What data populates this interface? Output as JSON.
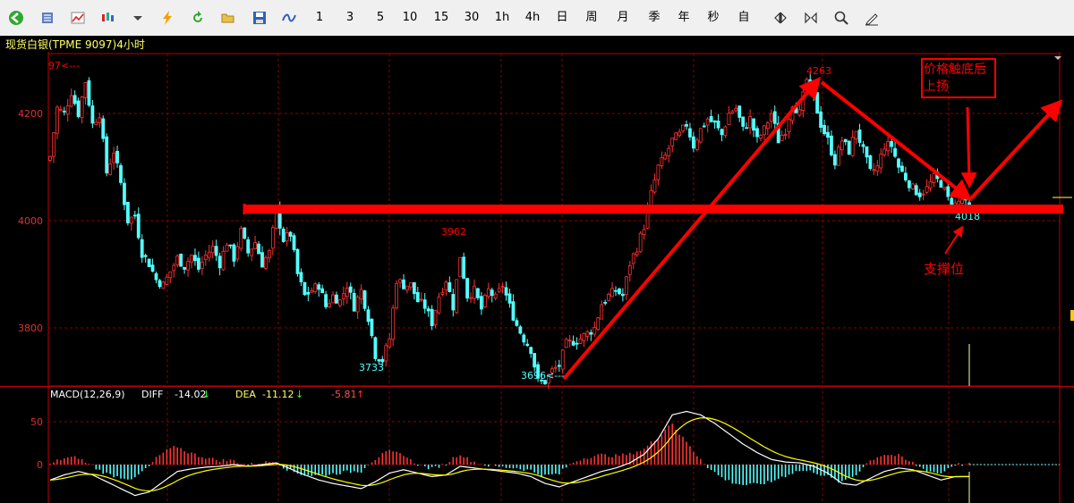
{
  "toolbar": {
    "icons": [
      "back-icon",
      "list-icon",
      "line-chart-icon",
      "candlestick-icon",
      "dropdown-arrow-icon",
      "lightning-icon",
      "refresh-icon",
      "open-folder-icon",
      "save-icon",
      "indicator-wave-icon"
    ],
    "periods": [
      "1",
      "3",
      "5",
      "10",
      "15",
      "30",
      "1h",
      "4h",
      "日",
      "周",
      "月",
      "季",
      "年",
      "秒",
      "自"
    ],
    "tools": [
      "zoom-in-out-icon",
      "zoom-fit-icon",
      "search-icon",
      "draw-pen-icon"
    ]
  },
  "title": "现货白银(TPME 9097)4小时",
  "colors": {
    "up": "#ff3232",
    "down": "#54ffff",
    "grid": "#8b0000",
    "axis": "#c00000",
    "annot": "#ff0000",
    "diff": "#ffffff",
    "dea": "#ffff00"
  },
  "chart_data": [
    {
      "type": "candlestick",
      "title": "现货白银(TPME 9097)4小时",
      "yticks": [
        3800,
        4000,
        4200
      ],
      "ylim": [
        3686,
        4313
      ],
      "grid": true,
      "price_labels": [
        {
          "text": "4263",
          "value": 4263
        },
        {
          "text": "3962",
          "value": 3962
        },
        {
          "text": "3733",
          "value": 3733
        },
        {
          "text": "3696<----",
          "value": 3696
        },
        {
          "text": "4018",
          "value": 4018
        },
        {
          "text": "97<---",
          "value": 4297
        }
      ],
      "waypoints": [
        [
          0,
          4120
        ],
        [
          2,
          4210
        ],
        [
          4,
          4200
        ],
        [
          6,
          4240
        ],
        [
          8,
          4200
        ],
        [
          10,
          4260
        ],
        [
          12,
          4180
        ],
        [
          14,
          4200
        ],
        [
          16,
          4090
        ],
        [
          18,
          4130
        ],
        [
          20,
          4070
        ],
        [
          22,
          4000
        ],
        [
          24,
          4010
        ],
        [
          26,
          3940
        ],
        [
          28,
          3920
        ],
        [
          30,
          3890
        ],
        [
          32,
          3880
        ],
        [
          34,
          3905
        ],
        [
          36,
          3930
        ],
        [
          38,
          3915
        ],
        [
          40,
          3935
        ],
        [
          42,
          3910
        ],
        [
          44,
          3935
        ],
        [
          46,
          3950
        ],
        [
          48,
          3920
        ],
        [
          50,
          3960
        ],
        [
          52,
          3930
        ],
        [
          54,
          3980
        ],
        [
          56,
          3940
        ],
        [
          58,
          3960
        ],
        [
          60,
          3920
        ],
        [
          62,
          3940
        ],
        [
          64,
          4020
        ],
        [
          66,
          3965
        ],
        [
          68,
          3975
        ],
        [
          70,
          3900
        ],
        [
          72,
          3860
        ],
        [
          74,
          3870
        ],
        [
          76,
          3880
        ],
        [
          78,
          3840
        ],
        [
          80,
          3860
        ],
        [
          82,
          3850
        ],
        [
          84,
          3880
        ],
        [
          86,
          3840
        ],
        [
          88,
          3870
        ],
        [
          90,
          3820
        ],
        [
          92,
          3750
        ],
        [
          94,
          3740
        ],
        [
          96,
          3780
        ],
        [
          98,
          3890
        ],
        [
          100,
          3880
        ],
        [
          102,
          3880
        ],
        [
          104,
          3850
        ],
        [
          106,
          3840
        ],
        [
          108,
          3810
        ],
        [
          110,
          3860
        ],
        [
          112,
          3890
        ],
        [
          114,
          3840
        ],
        [
          116,
          3935
        ],
        [
          118,
          3860
        ],
        [
          120,
          3870
        ],
        [
          122,
          3835
        ],
        [
          124,
          3870
        ],
        [
          126,
          3855
        ],
        [
          128,
          3880
        ],
        [
          130,
          3840
        ],
        [
          132,
          3805
        ],
        [
          134,
          3780
        ],
        [
          136,
          3760
        ],
        [
          138,
          3700
        ],
        [
          140,
          3700
        ],
        [
          142,
          3720
        ],
        [
          144,
          3730
        ],
        [
          146,
          3770
        ],
        [
          148,
          3775
        ],
        [
          150,
          3780
        ],
        [
          152,
          3790
        ],
        [
          154,
          3800
        ],
        [
          156,
          3845
        ],
        [
          158,
          3860
        ],
        [
          160,
          3870
        ],
        [
          162,
          3860
        ],
        [
          164,
          3920
        ],
        [
          166,
          3950
        ],
        [
          168,
          3990
        ],
        [
          170,
          4050
        ],
        [
          172,
          4100
        ],
        [
          174,
          4120
        ],
        [
          176,
          4150
        ],
        [
          178,
          4160
        ],
        [
          180,
          4180
        ],
        [
          182,
          4140
        ],
        [
          184,
          4170
        ],
        [
          186,
          4190
        ],
        [
          188,
          4180
        ],
        [
          190,
          4160
        ],
        [
          192,
          4200
        ],
        [
          194,
          4210
        ],
        [
          196,
          4170
        ],
        [
          198,
          4190
        ],
        [
          200,
          4150
        ],
        [
          202,
          4170
        ],
        [
          204,
          4200
        ],
        [
          206,
          4150
        ],
        [
          208,
          4170
        ],
        [
          210,
          4220
        ],
        [
          212,
          4200
        ],
        [
          214,
          4263
        ],
        [
          216,
          4230
        ],
        [
          218,
          4180
        ],
        [
          220,
          4150
        ],
        [
          222,
          4110
        ],
        [
          224,
          4150
        ],
        [
          226,
          4130
        ],
        [
          228,
          4170
        ],
        [
          230,
          4130
        ],
        [
          232,
          4090
        ],
        [
          234,
          4100
        ],
        [
          236,
          4140
        ],
        [
          238,
          4140
        ],
        [
          240,
          4100
        ],
        [
          242,
          4080
        ],
        [
          244,
          4060
        ],
        [
          246,
          4050
        ],
        [
          248,
          4060
        ],
        [
          250,
          4080
        ],
        [
          252,
          4070
        ],
        [
          254,
          4040
        ],
        [
          256,
          4030
        ],
        [
          258,
          4040
        ],
        [
          260,
          4020
        ]
      ]
    },
    {
      "type": "bar",
      "title": "MACD(12,26,9)",
      "legend": [
        {
          "name": "DIFF",
          "value": "-14.02",
          "arrow": "↓"
        },
        {
          "name": "DEA",
          "value": "-11.12",
          "arrow": "↓"
        },
        {
          "name": "",
          "value": "-5.81",
          "arrow": "↑"
        }
      ],
      "yticks": [
        0,
        50
      ],
      "ylim": [
        -45,
        70
      ],
      "macd_waypoints": [
        [
          0,
          -18
        ],
        [
          4,
          -12
        ],
        [
          8,
          -8
        ],
        [
          12,
          -12
        ],
        [
          16,
          -20
        ],
        [
          20,
          -28
        ],
        [
          24,
          -36
        ],
        [
          28,
          -32
        ],
        [
          32,
          -20
        ],
        [
          36,
          -8
        ],
        [
          40,
          -5
        ],
        [
          44,
          -3
        ],
        [
          48,
          -2
        ],
        [
          52,
          0
        ],
        [
          56,
          -2
        ],
        [
          60,
          0
        ],
        [
          64,
          2
        ],
        [
          68,
          -5
        ],
        [
          72,
          -12
        ],
        [
          76,
          -18
        ],
        [
          80,
          -22
        ],
        [
          84,
          -25
        ],
        [
          88,
          -28
        ],
        [
          92,
          -20
        ],
        [
          96,
          -10
        ],
        [
          100,
          -6
        ],
        [
          104,
          -10
        ],
        [
          108,
          -14
        ],
        [
          112,
          -12
        ],
        [
          116,
          -2
        ],
        [
          120,
          -4
        ],
        [
          124,
          -6
        ],
        [
          128,
          -8
        ],
        [
          132,
          -10
        ],
        [
          136,
          -14
        ],
        [
          140,
          -22
        ],
        [
          144,
          -26
        ],
        [
          148,
          -20
        ],
        [
          152,
          -14
        ],
        [
          156,
          -8
        ],
        [
          160,
          -4
        ],
        [
          164,
          2
        ],
        [
          168,
          12
        ],
        [
          172,
          30
        ],
        [
          176,
          58
        ],
        [
          180,
          62
        ],
        [
          184,
          58
        ],
        [
          188,
          48
        ],
        [
          192,
          36
        ],
        [
          196,
          24
        ],
        [
          200,
          14
        ],
        [
          204,
          6
        ],
        [
          208,
          3
        ],
        [
          212,
          2
        ],
        [
          216,
          -2
        ],
        [
          220,
          -10
        ],
        [
          224,
          -22
        ],
        [
          228,
          -24
        ],
        [
          232,
          -16
        ],
        [
          236,
          -8
        ],
        [
          240,
          -4
        ],
        [
          244,
          -6
        ],
        [
          248,
          -12
        ],
        [
          252,
          -18
        ],
        [
          256,
          -14
        ],
        [
          260,
          -14
        ]
      ]
    }
  ],
  "annotations": {
    "box_label_line1": "价格触底后",
    "box_label_line2": "上扬",
    "support_label": "支撑位"
  }
}
